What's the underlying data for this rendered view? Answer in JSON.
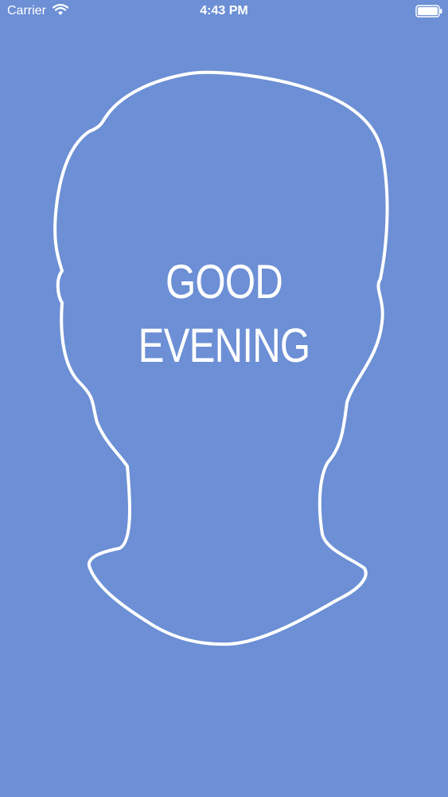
{
  "status_bar": {
    "carrier": "Carrier",
    "time": "4:43 PM",
    "wifi_icon": "wifi-icon",
    "battery_icon": "battery-icon"
  },
  "greeting": {
    "line1": "GOOD",
    "line2": "EVENING"
  },
  "graphic": {
    "name": "head-silhouette-outline",
    "stroke_color": "#ffffff"
  },
  "colors": {
    "background": "#6c8fd5",
    "text": "#ffffff"
  }
}
